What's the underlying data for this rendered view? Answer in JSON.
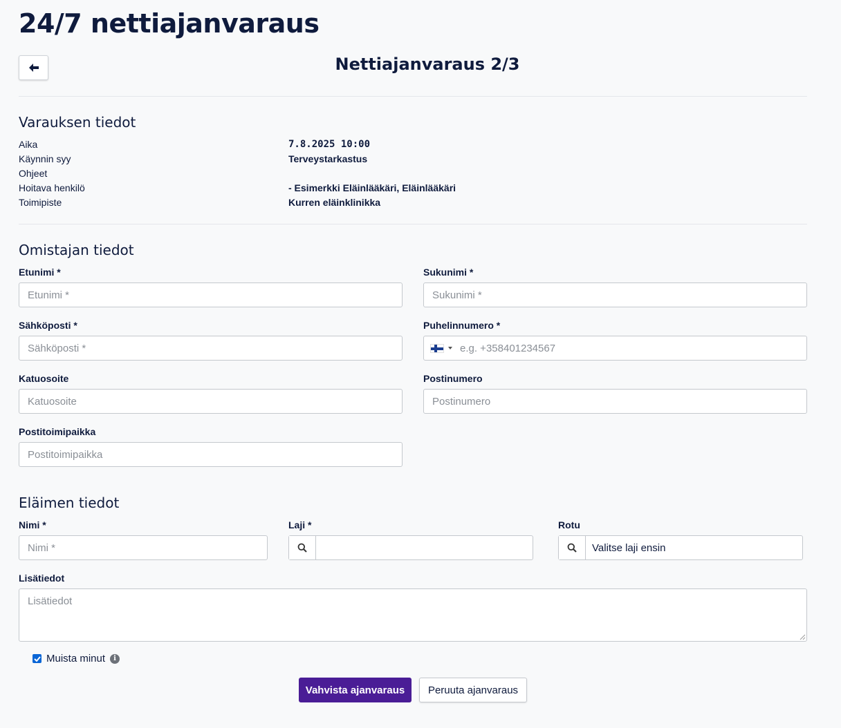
{
  "header": {
    "title": "24/7 nettiajanvaraus",
    "step_title": "Nettiajanvaraus 2/3",
    "back_icon": "arrow-left-icon"
  },
  "booking": {
    "section_title": "Varauksen tiedot",
    "rows": [
      {
        "label": "Aika",
        "value": "7.8.2025 10:00"
      },
      {
        "label": "Käynnin syy",
        "value": "Terveystarkastus"
      },
      {
        "label": "Ohjeet",
        "value": ""
      },
      {
        "label": "Hoitava henkilö",
        "value": "- Esimerkki Eläinlääkäri, Eläinlääkäri"
      },
      {
        "label": "Toimipiste",
        "value": "Kurren eläinklinikka"
      }
    ]
  },
  "owner": {
    "section_title": "Omistajan tiedot",
    "first_name": {
      "label": "Etunimi *",
      "placeholder": "Etunimi *",
      "value": ""
    },
    "last_name": {
      "label": "Sukunimi *",
      "placeholder": "Sukunimi *",
      "value": ""
    },
    "email": {
      "label": "Sähköposti *",
      "placeholder": "Sähköposti *",
      "value": ""
    },
    "phone": {
      "label": "Puhelinnumero *",
      "placeholder": "e.g. +358401234567",
      "value": "",
      "country_flag": "finland-flag-icon"
    },
    "street": {
      "label": "Katuosoite",
      "placeholder": "Katuosoite",
      "value": ""
    },
    "postal_code": {
      "label": "Postinumero",
      "placeholder": "Postinumero",
      "value": ""
    },
    "city": {
      "label": "Postitoimipaikka",
      "placeholder": "Postitoimipaikka",
      "value": ""
    }
  },
  "animal": {
    "section_title": "Eläimen tiedot",
    "name": {
      "label": "Nimi *",
      "placeholder": "Nimi *",
      "value": ""
    },
    "species": {
      "label": "Laji *",
      "value": ""
    },
    "breed": {
      "label": "Rotu",
      "value": "Valitse laji ensin"
    },
    "notes": {
      "label": "Lisätiedot",
      "placeholder": "Lisätiedot",
      "value": ""
    }
  },
  "remember_me": {
    "label": "Muista minut",
    "checked": true
  },
  "actions": {
    "confirm_label": "Vahvista ajanvaraus",
    "cancel_label": "Peruuta ajanvaraus"
  },
  "colors": {
    "primary": "#4a1d96",
    "text": "#0f1b3d",
    "background": "#f8f9fa",
    "checkbox": "#0a66d6"
  }
}
